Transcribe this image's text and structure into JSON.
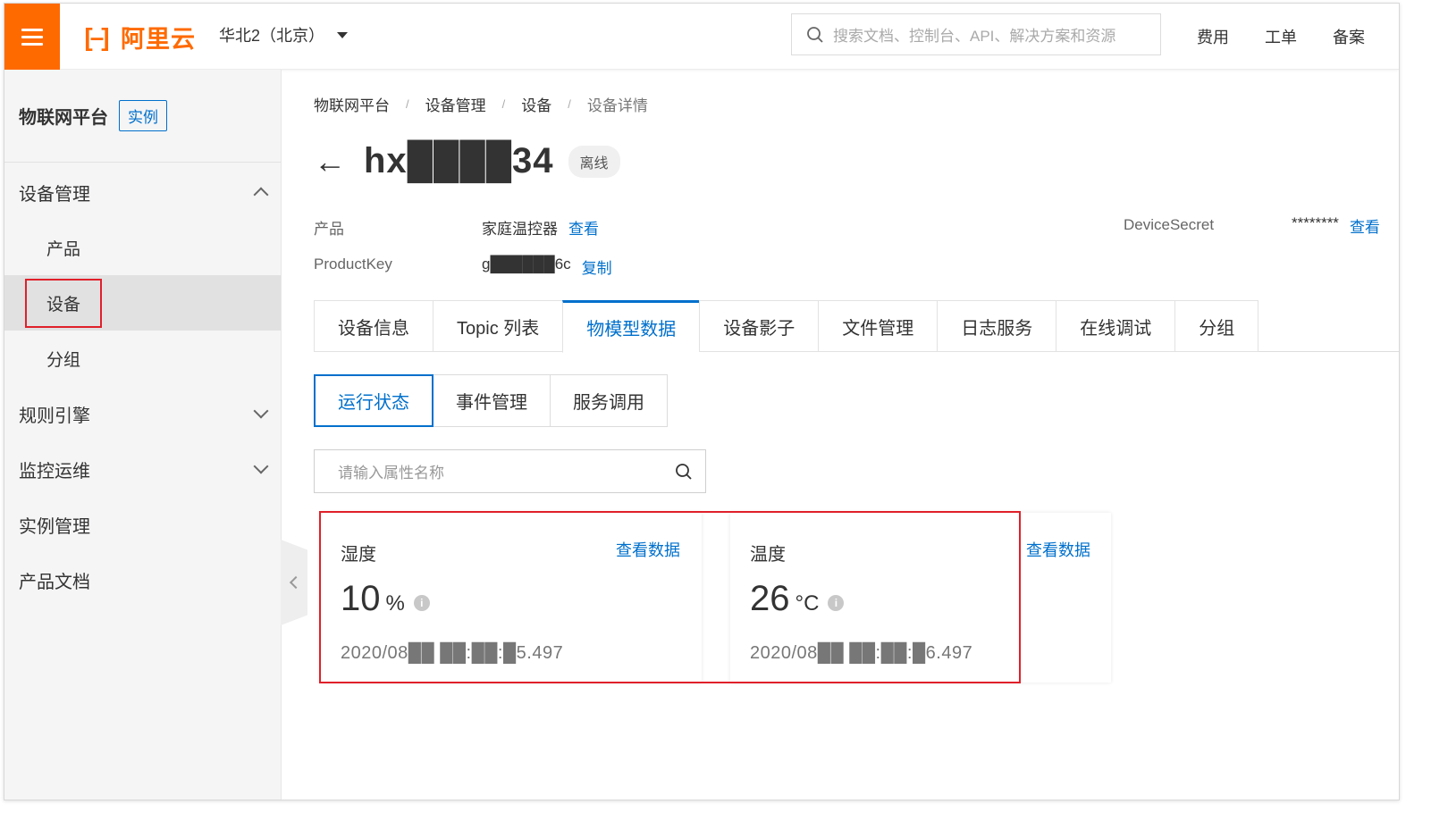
{
  "topbar": {
    "logo_text": "阿里云",
    "region": "华北2（北京）",
    "search_placeholder": "搜索文档、控制台、API、解决方案和资源",
    "links": [
      "费用",
      "工单",
      "备案"
    ]
  },
  "sidebar": {
    "title": "物联网平台",
    "badge": "实例",
    "groups": {
      "device_mgmt": "设备管理",
      "rules": "规则引擎",
      "monitor": "监控运维",
      "instance": "实例管理",
      "docs": "产品文档"
    },
    "items": [
      "产品",
      "设备",
      "分组"
    ]
  },
  "breadcrumb": [
    "物联网平台",
    "设备管理",
    "设备",
    "设备详情"
  ],
  "device": {
    "name": "hx████34",
    "status": "离线",
    "product_label": "产品",
    "product_value": "家庭温控器",
    "product_link": "查看",
    "productkey_label": "ProductKey",
    "productkey_value": "g██████6c",
    "productkey_link": "复制",
    "secret_label": "DeviceSecret",
    "secret_value": "********",
    "secret_link": "查看"
  },
  "tabs": [
    "设备信息",
    "Topic 列表",
    "物模型数据",
    "设备影子",
    "文件管理",
    "日志服务",
    "在线调试",
    "分组"
  ],
  "active_tab": "物模型数据",
  "subtabs": [
    "运行状态",
    "事件管理",
    "服务调用"
  ],
  "property_search_placeholder": "请输入属性名称",
  "cards": [
    {
      "title": "湿度",
      "link": "查看数据",
      "value": "10",
      "unit": "%",
      "time": "2020/08██ ██:██:█5.497"
    },
    {
      "title": "温度",
      "link": "查看数据",
      "value": "26",
      "unit": "°C",
      "time": "2020/08██ ██:██:█6.497"
    }
  ],
  "colors": {
    "brand": "#ff6a00",
    "link": "#0070cc",
    "highlight": "#e0202a"
  }
}
